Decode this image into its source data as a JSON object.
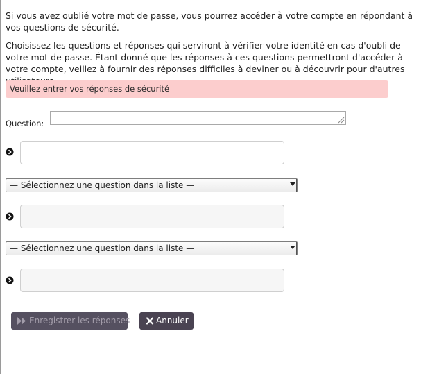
{
  "intro": {
    "paragraph1": "Si vous avez oublié votre mot de passe, vous pourrez accéder à votre compte en répondant à vos questions de sécurité.",
    "paragraph2": "Choisissez les questions et réponses qui serviront à vérifier votre identité en cas d'oubli de votre mot de passe. Étant donné que les réponses à ces questions permettront d'accéder à votre compte, veillez à fournir des réponses difficiles à deviner ou à découvrir pour d'autres utilisateurs."
  },
  "alert": {
    "message": "Veuillez entrer vos réponses de sécurité",
    "color": "#fccdcd"
  },
  "question1": {
    "label": "Question:",
    "value": "",
    "answer_value": ""
  },
  "question2": {
    "selected": "— Sélectionnez une question dans la liste —",
    "answer_value": ""
  },
  "question3": {
    "selected": "— Sélectionnez une question dans la liste —",
    "answer_value": ""
  },
  "buttons": {
    "save_label": "Enregistrer les réponses",
    "save_icon": "fast-forward-icon",
    "cancel_label": "Annuler",
    "cancel_icon": "close-icon",
    "color": "#4a4352"
  }
}
